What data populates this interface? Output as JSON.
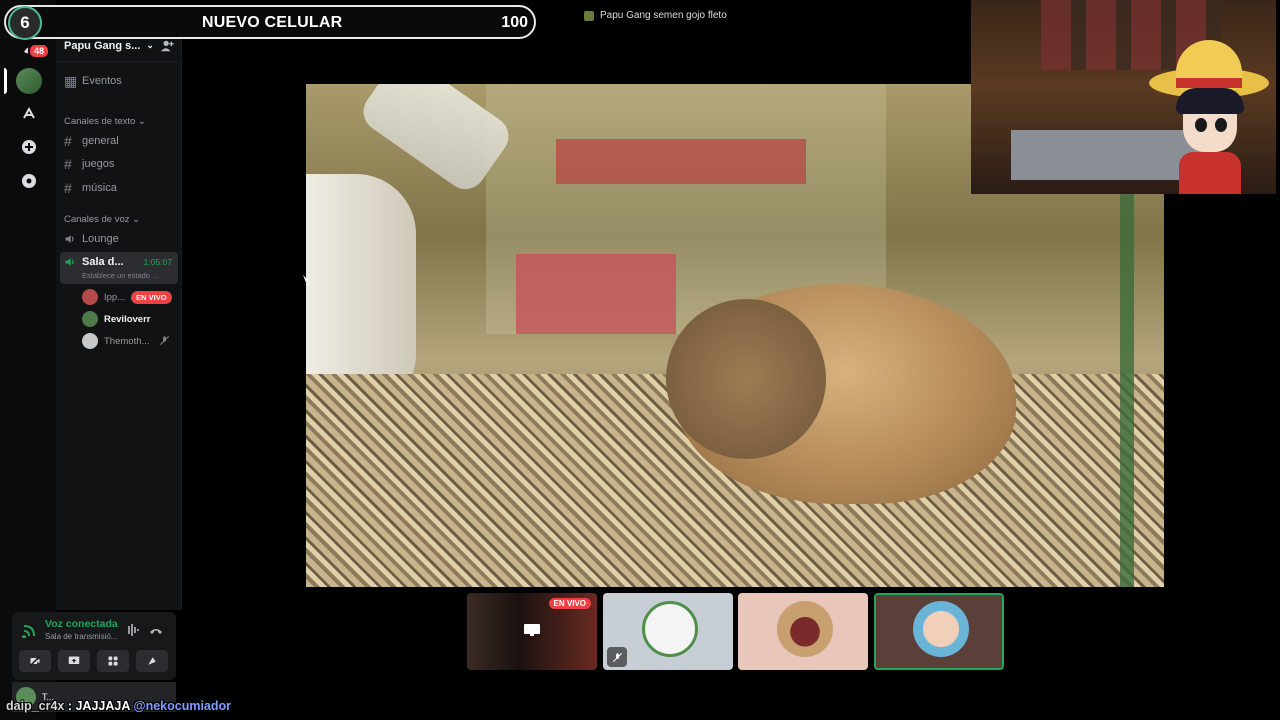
{
  "overlay": {
    "goal_number": "6",
    "goal_label": "NUEVO CELULAR",
    "goal_count": "100"
  },
  "rail": {
    "dm_badge": "48",
    "icons": [
      "home-icon",
      "server-avatar",
      "discover-icon",
      "add-server-icon",
      "explore-icon"
    ]
  },
  "sidebar": {
    "server_name": "Papu Gang s...",
    "events_label": "Eventos",
    "text_category": "Canales de texto",
    "text_channels": [
      "general",
      "juegos",
      "música"
    ],
    "voice_category": "Canales de voz",
    "voice_channels": {
      "lounge": "Lounge",
      "active": {
        "name": "Sala d...",
        "timer": "1:05:07",
        "status": "Establece un estado ..."
      }
    },
    "members": [
      {
        "name": "Ipp...",
        "badge": "EN VIVO"
      },
      {
        "name": "Reviloverr"
      },
      {
        "name": "Themoth..."
      }
    ]
  },
  "voice_panel": {
    "status": "Voz conectada",
    "channel": "Sala de transmisió..."
  },
  "user_panel": {
    "name": "T..."
  },
  "topbar": {
    "title": "Papu Gang semen gojo fleto"
  },
  "tiles": [
    {
      "badge": "EN VIVO"
    },
    {
      "muted": true
    },
    {},
    {
      "speaking": true
    }
  ],
  "chat": {
    "user": "daip_cr4x",
    "separator": " : ",
    "message": "JAJJAJA ",
    "mention": "@nekocumiador"
  },
  "colors": {
    "accent_green": "#23a55a",
    "live_red": "#ed4245",
    "mention_blue": "#7f9cff"
  }
}
